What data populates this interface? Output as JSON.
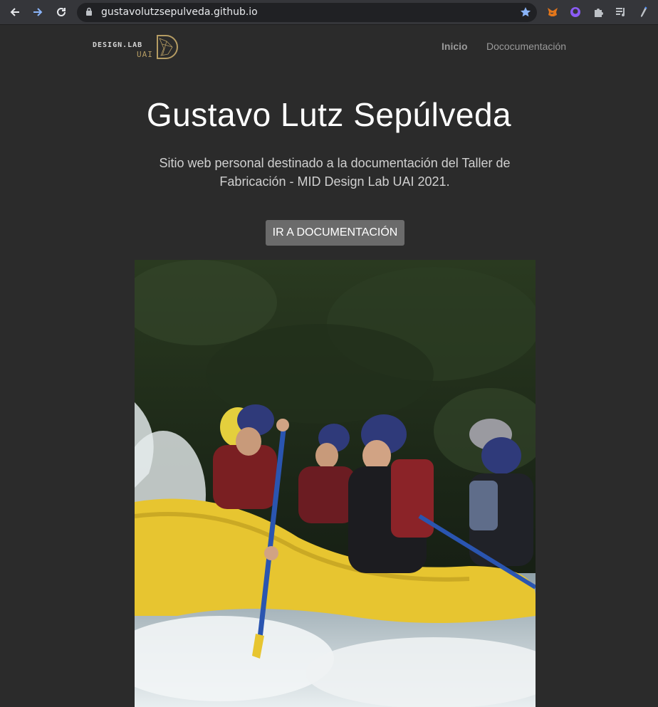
{
  "browser": {
    "url": "gustavolutzsepulveda.github.io",
    "icons": [
      "back-icon",
      "forward-icon",
      "reload-icon",
      "lock-icon",
      "bookmark-star-icon",
      "metamask-fox-icon",
      "github-icon",
      "extensions-puzzle-icon",
      "media-queue-icon",
      "profile-icon"
    ]
  },
  "site": {
    "logo": {
      "main": "DESIGN.LAB",
      "sub": "UAI"
    },
    "nav": {
      "home": "Inicio",
      "docs": "Dococumentación"
    },
    "hero": {
      "title": "Gustavo Lutz Sepúlveda",
      "subtitle": "Sitio web personal destinado a la documentación del Taller de Fabricación - MID Design Lab UAI 2021.",
      "cta": "IR A DOCUMENTACIÓN"
    }
  },
  "colors": {
    "page_bg": "#2b2b2b",
    "button_bg": "#6b6b6b",
    "logo_accent": "#b59c63",
    "chrome_bg": "#35363a"
  }
}
